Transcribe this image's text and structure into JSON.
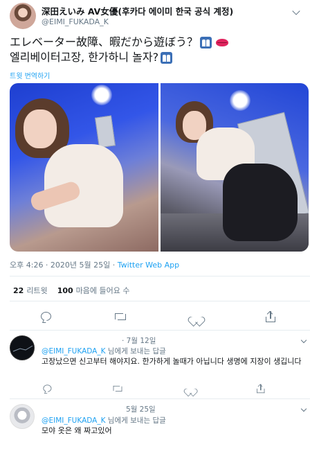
{
  "tweet": {
    "display_name": "深田えいみ AV女優(후카다 에이미 한국 공식 계정)",
    "handle": "@EIMI_FUKADA_K",
    "text_line1": "エレベーター故障、暇だから遊ぼう？",
    "text_line2": "엘리베이터고장, 한가하니 놀자?",
    "emoji_line1": [
      "elevator-emoji",
      "lips-emoji"
    ],
    "emoji_line2": [
      "elevator-emoji"
    ],
    "translate_label": "트윗 번역하기",
    "time": "오후 4:26 · 2020년 5월 25일 · ",
    "source": "Twitter Web App",
    "retweets_count": "22",
    "retweets_label": "리트윗",
    "likes_count": "100",
    "likes_label": "마음에 들어요 수"
  },
  "actions": [
    "reply-icon",
    "retweet-icon",
    "heart-icon",
    "share-icon"
  ],
  "replies": [
    {
      "date": "· 7월 12일",
      "replying_to": "@EIMI_FUKADA_K",
      "replying_suffix": " 님에게 보내는 답글",
      "text": "고장났으면 신고부터 해야지요. 한가하게 놀때가 아닙니다 생명에 지장이 생깁니다"
    },
    {
      "date": "5월 25일",
      "replying_to": "@EIMI_FUKADA_K",
      "replying_suffix": " 님에게 보내는 답글",
      "text": "모야 옷은 왜 짜고있어"
    }
  ],
  "colors": {
    "accent": "#1da1f2",
    "muted": "#657786",
    "text": "#14171a",
    "divider": "#e6ecf0",
    "emoji_red": "#e0245e"
  }
}
